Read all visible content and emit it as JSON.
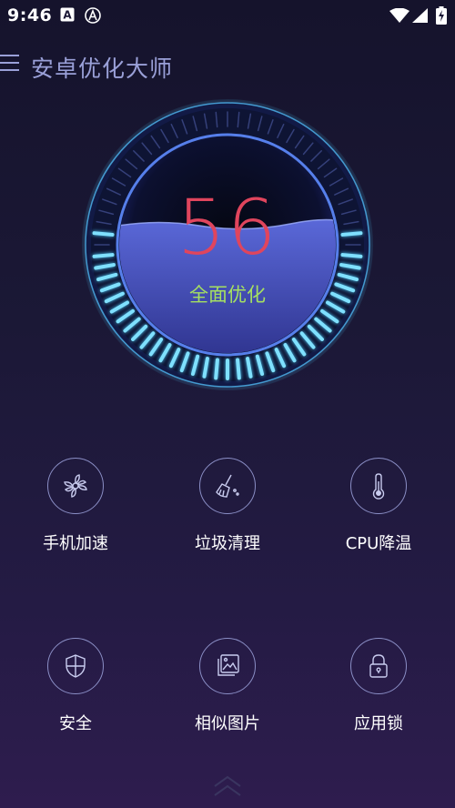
{
  "status_bar": {
    "time": "9:46"
  },
  "app_bar": {
    "title": "安卓优化大师"
  },
  "gauge": {
    "score": "56",
    "action_label": "全面优化"
  },
  "features": [
    {
      "label": "手机加速",
      "icon": "fan-icon"
    },
    {
      "label": "垃圾清理",
      "icon": "broom-icon"
    },
    {
      "label": "CPU降温",
      "icon": "thermometer-icon"
    },
    {
      "label": "安全",
      "icon": "shield-icon"
    },
    {
      "label": "相似图片",
      "icon": "photo-stack-icon"
    },
    {
      "label": "应用锁",
      "icon": "padlock-icon"
    }
  ],
  "colors": {
    "background": "#1b1836",
    "title": "#9aa0d8",
    "score": "#e0455d",
    "action": "#a5e061",
    "gauge_glow": "#4fd2ff"
  }
}
